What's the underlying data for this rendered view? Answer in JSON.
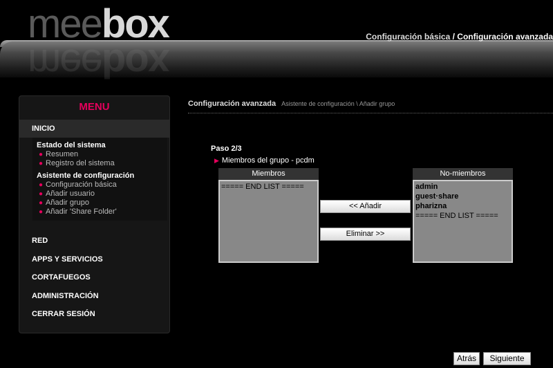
{
  "brand": {
    "logo_part1": "mee",
    "logo_part2": "box"
  },
  "topnav": {
    "basic": "Configuración básica",
    "separator": " / ",
    "advanced": "Configuración avanzada"
  },
  "sidebar": {
    "title": "MENU",
    "inicio": "INICIO",
    "estado": {
      "heading": "Estado del sistema",
      "links": [
        "Resumen",
        "Registro del sistema"
      ]
    },
    "asistente": {
      "heading": "Asistente de configuración",
      "links": [
        "Configuración básica",
        "Añadir usuario",
        "Añadir grupo",
        "Añadir 'Share Folder'"
      ]
    },
    "items": [
      "RED",
      "APPS Y SERVICIOS",
      "CORTAFUEGOS",
      "ADMINISTRACIÓN",
      "CERRAR SESIÓN"
    ]
  },
  "breadcrumb": {
    "main": "Configuración avanzada",
    "sub": "Asistente de configuración \\ Añadir grupo"
  },
  "wizard": {
    "step": "Paso 2/3",
    "group_label": "Miembros del grupo - pcdm",
    "members": {
      "header": "Miembros",
      "options": [
        "===== END LIST ====="
      ]
    },
    "non_members": {
      "header": "No-miembros",
      "options": [
        "admin",
        "guest·share",
        "pharizna",
        "===== END LIST ====="
      ]
    },
    "add_button": "<< Añadir",
    "remove_button": "Eliminar >>"
  },
  "footer": {
    "back": "Atrás",
    "next": "Siguiente"
  },
  "colors": {
    "accent": "#e6005c",
    "background": "#000000"
  }
}
